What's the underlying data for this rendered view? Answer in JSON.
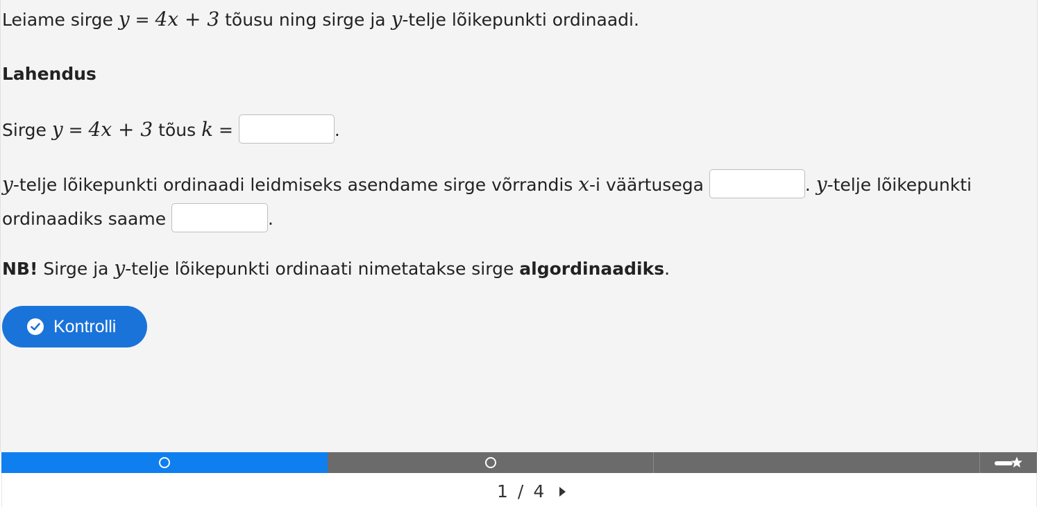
{
  "task": {
    "intro_prefix": "Leiame sirge ",
    "intro_eq_y": "y",
    "intro_eq_mid": " = ",
    "intro_eq_rhs": "4x + 3",
    "intro_suffix": " tõusu ning sirge ja ",
    "intro_var_y": "y",
    "intro_end": "-telje lõikepunkti ordinaadi."
  },
  "solution": {
    "heading": "Lahendus",
    "line1_prefix": "Sirge ",
    "line1_y": "y",
    "line1_eq": " = ",
    "line1_rhs": "4x + 3",
    "line1_mid": " tõus ",
    "line1_k": "k",
    "line1_eq2": " = ",
    "line1_end": ".",
    "line2_y": "y",
    "line2_text": "-telje lõikepunkti ordinaadi leidmiseks asendame sirge võrrandis ",
    "line2_x": "x",
    "line2_text2": "-i väärtusega ",
    "line2_end": ".  ",
    "line2_y2": "y",
    "line2_text3": "-telje lõikepunkti",
    "line3_text": "ordinaadiks saame ",
    "line3_end": ".",
    "answers": [
      "",
      "",
      ""
    ]
  },
  "note": {
    "label": "NB!",
    "text1": " Sirge ja ",
    "y": "y",
    "text2": "-telje lõikepunkti ordinaati nimetatakse sirge ",
    "term": "algordinaadiks",
    "end": "."
  },
  "check_button": {
    "label": "Kontrolli"
  },
  "progress": {
    "current_page": "1",
    "separator": "/",
    "total_pages": "4"
  },
  "colors": {
    "accent": "#1a73d9",
    "progress_active": "#0f7ff0",
    "progress_inactive": "#6b6b6b",
    "background": "#f4f4f4"
  }
}
